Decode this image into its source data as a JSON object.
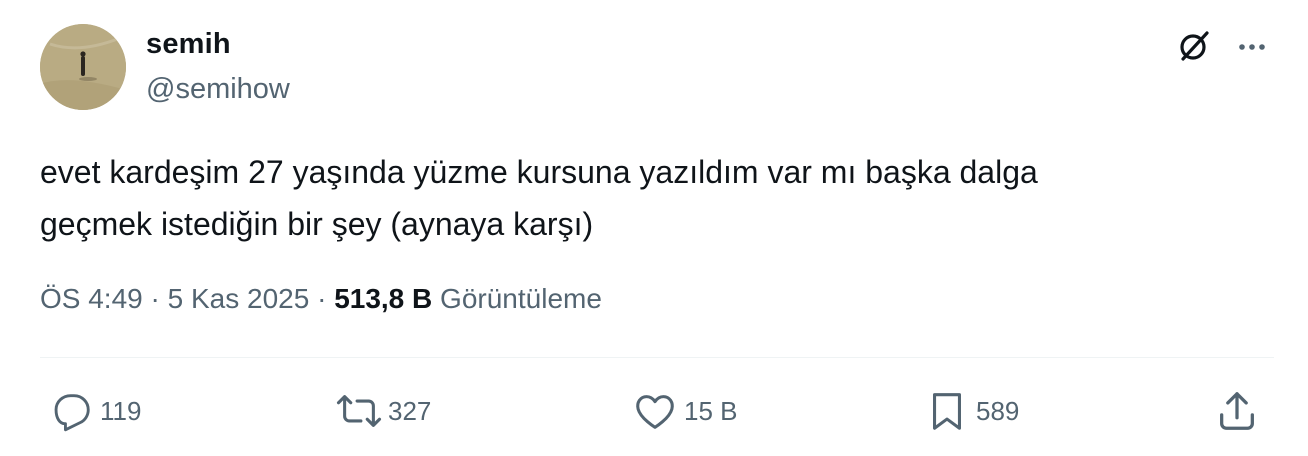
{
  "author": {
    "display_name": "semih",
    "handle": "@semihow",
    "avatar_icon": "avatar-photo"
  },
  "header_actions": {
    "grok_icon": "grok-icon",
    "more_icon": "more-options-icon"
  },
  "tweet": {
    "text_line1": "evet kardeşim 27 yaşında yüzme kursuna yazıldım var mı başka dalga",
    "text_line2": "geçmek istediğin bir şey (aynaya karşı)"
  },
  "meta": {
    "time": "ÖS 4:49",
    "separator": "·",
    "date": "5 Kas 2025",
    "views_count": "513,8 B",
    "views_label": "Görüntüleme"
  },
  "actions": {
    "reply": {
      "icon": "reply-icon",
      "count": "119"
    },
    "retweet": {
      "icon": "retweet-icon",
      "count": "327"
    },
    "like": {
      "icon": "heart-icon",
      "count": "15 B"
    },
    "bookmark": {
      "icon": "bookmark-icon",
      "count": "589"
    },
    "share": {
      "icon": "share-icon"
    }
  },
  "colors": {
    "text_primary": "#0f1419",
    "text_secondary": "#536471",
    "divider": "#eff3f4",
    "background": "#ffffff"
  }
}
